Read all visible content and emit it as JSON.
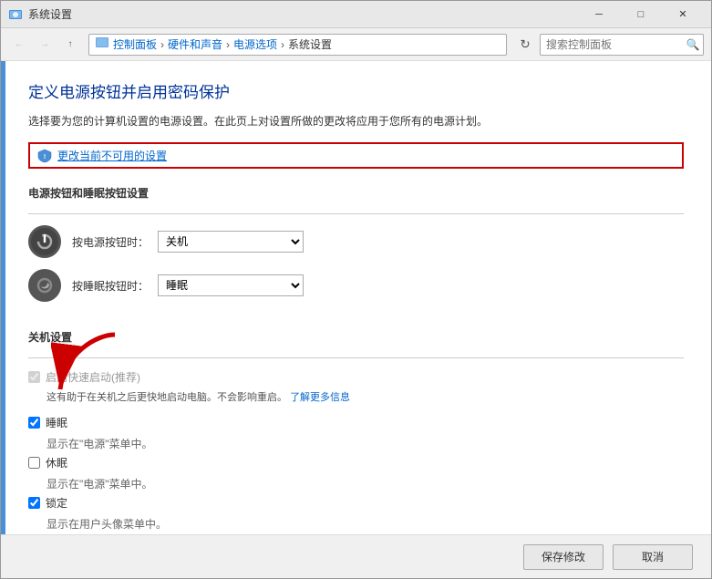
{
  "window": {
    "title": "系统设置",
    "min_btn": "─",
    "max_btn": "□",
    "close_btn": "✕"
  },
  "nav": {
    "back_tooltip": "后退",
    "forward_tooltip": "前进",
    "up_tooltip": "向上",
    "refresh_tooltip": "刷新",
    "breadcrumb": {
      "item1": "控制面板",
      "item2": "硬件和声音",
      "item3": "电源选项",
      "current": "系统设置"
    },
    "search_placeholder": "搜索控制面板"
  },
  "page": {
    "title": "定义电源按钮并启用密码保护",
    "desc": "选择要为您的计算机设置的电源设置。在此页上对设置所做的更改将应用于您所有的电源计划。",
    "change_settings_btn": "更改当前不可用的设置",
    "power_sleep_section": "电源按钮和睡眠按钮设置",
    "power_btn_label": "按电源按钮时：",
    "power_btn_value": "关机",
    "sleep_btn_label": "按睡眠按钮时：",
    "sleep_btn_value": "睡眠",
    "shutdown_section": "关机设置",
    "fast_startup_label": "启用快速启动(推荐)",
    "fast_startup_desc": "这有助于在关机之后更快地启动电脑。不会影响重启。",
    "fast_startup_link": "了解更多信息",
    "sleep_label": "睡眠",
    "sleep_desc": "显示在\"电源\"菜单中。",
    "hibernate_label": "休眠",
    "hibernate_desc": "显示在\"电源\"菜单中。",
    "lock_label": "锁定",
    "lock_desc": "显示在用户头像菜单中。",
    "save_btn": "保存修改",
    "cancel_btn": "取消"
  }
}
